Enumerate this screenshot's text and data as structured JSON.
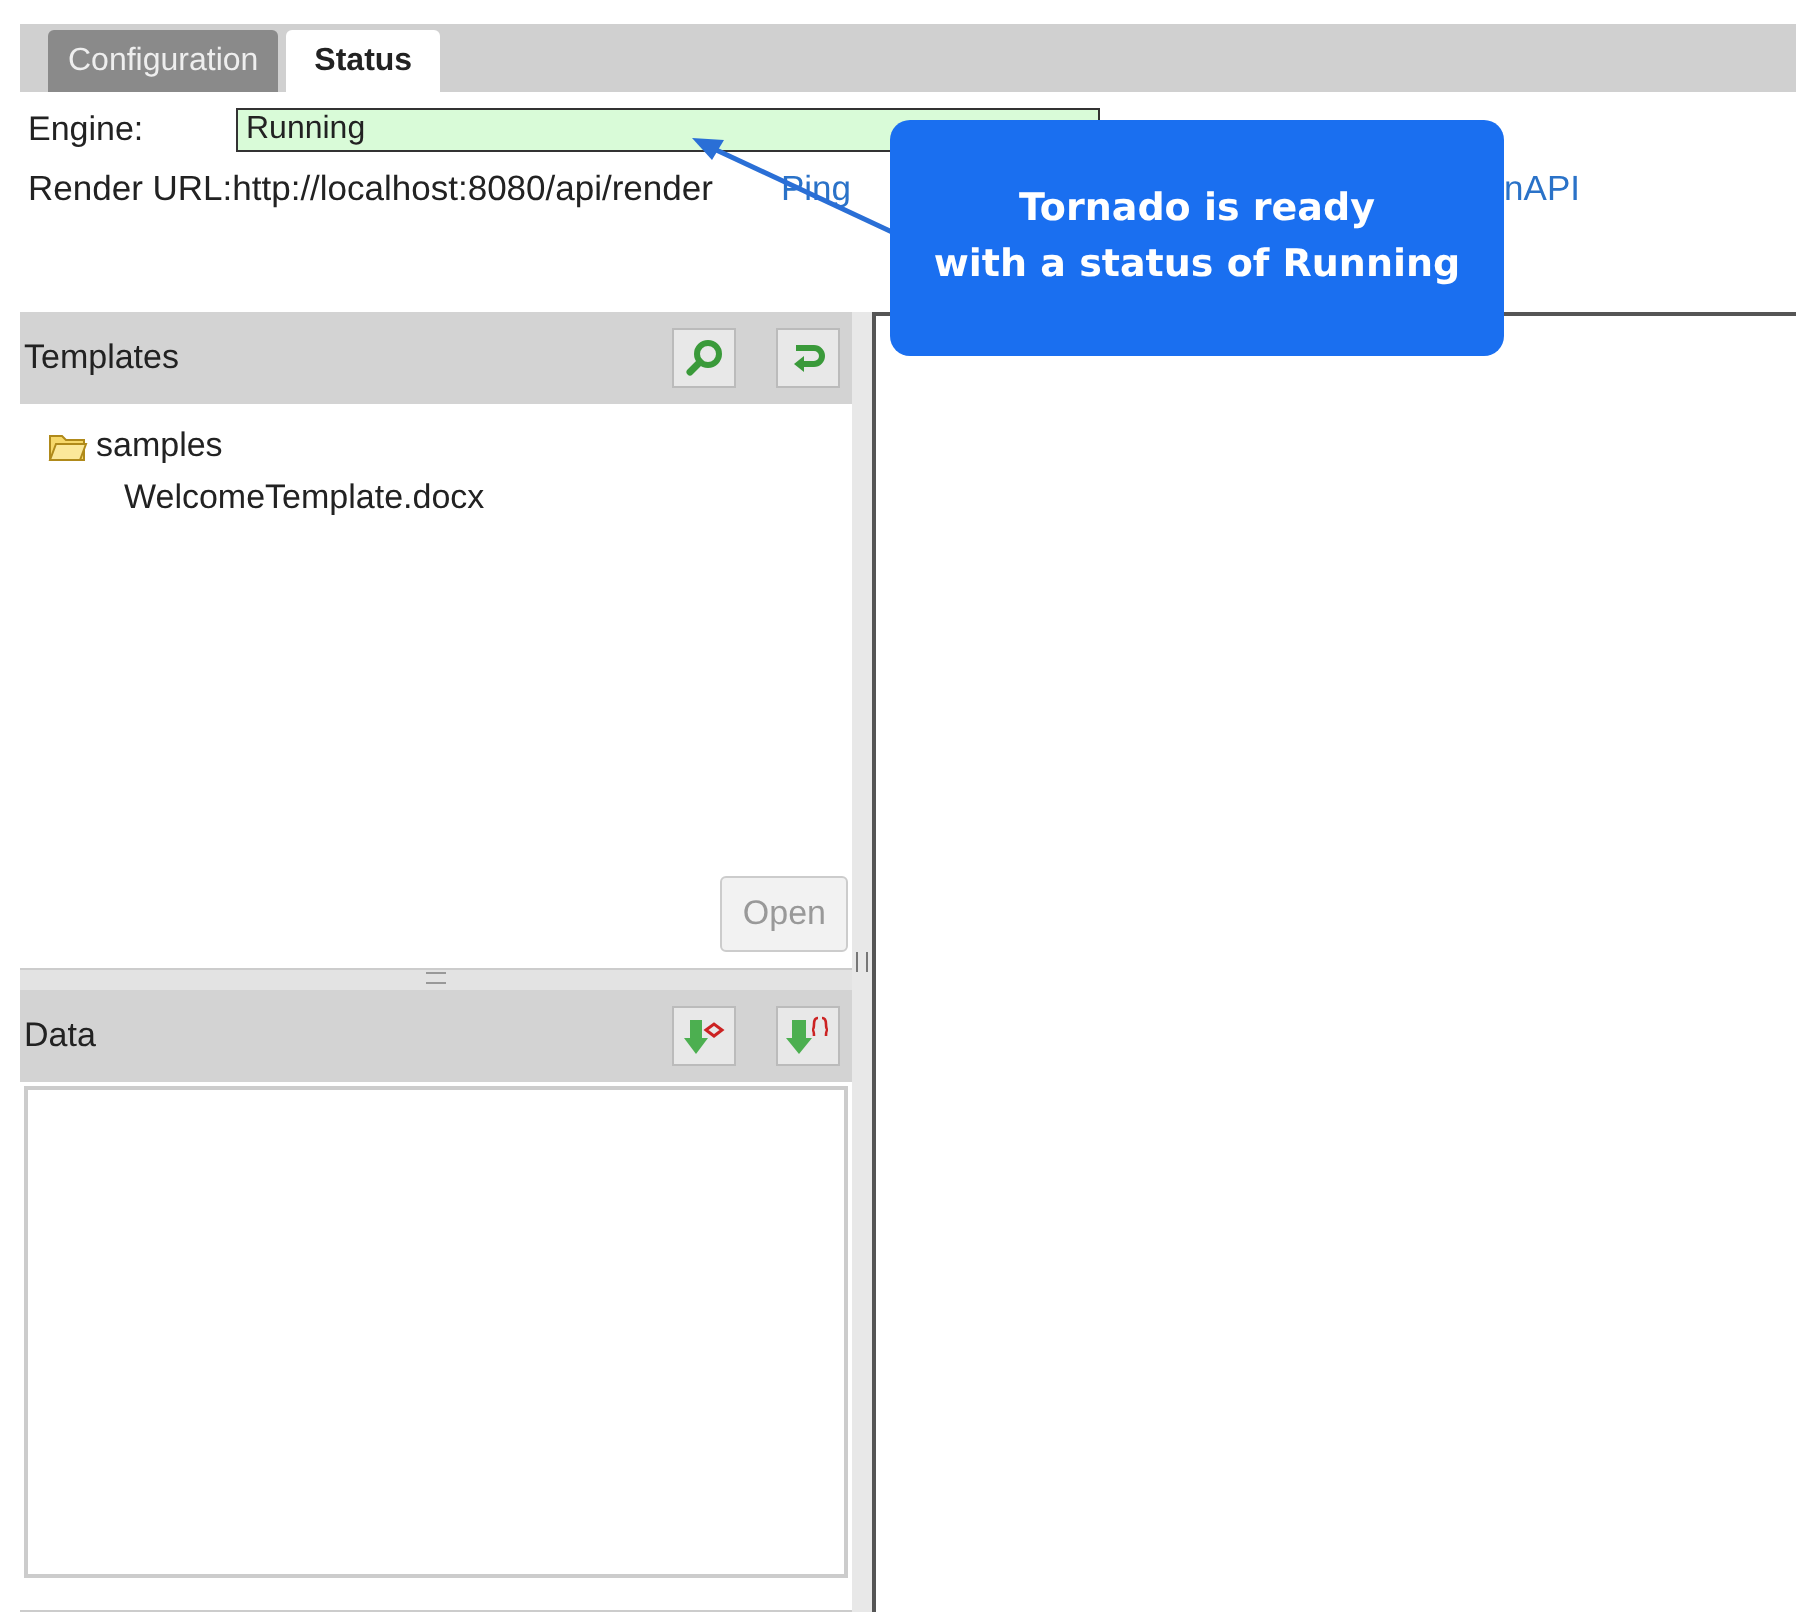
{
  "tabs": [
    {
      "label": "Configuration",
      "selected": false
    },
    {
      "label": "Status",
      "selected": true
    }
  ],
  "engine": {
    "label": "Engine:",
    "value": "Running"
  },
  "render_url": {
    "label": "Render URL:",
    "value": "http://localhost:8080/api/render"
  },
  "links": [
    "Ping",
    "nAPI"
  ],
  "callout": {
    "text": "Tornado is ready\nwith a status of Running"
  },
  "templates": {
    "title": "Templates",
    "tree": [
      {
        "label": "samples",
        "expanded": true,
        "children": [
          {
            "label": "WelcomeTemplate.docx"
          }
        ]
      }
    ],
    "open_button": {
      "label": "Open",
      "disabled": true
    }
  },
  "data": {
    "title": "Data"
  }
}
